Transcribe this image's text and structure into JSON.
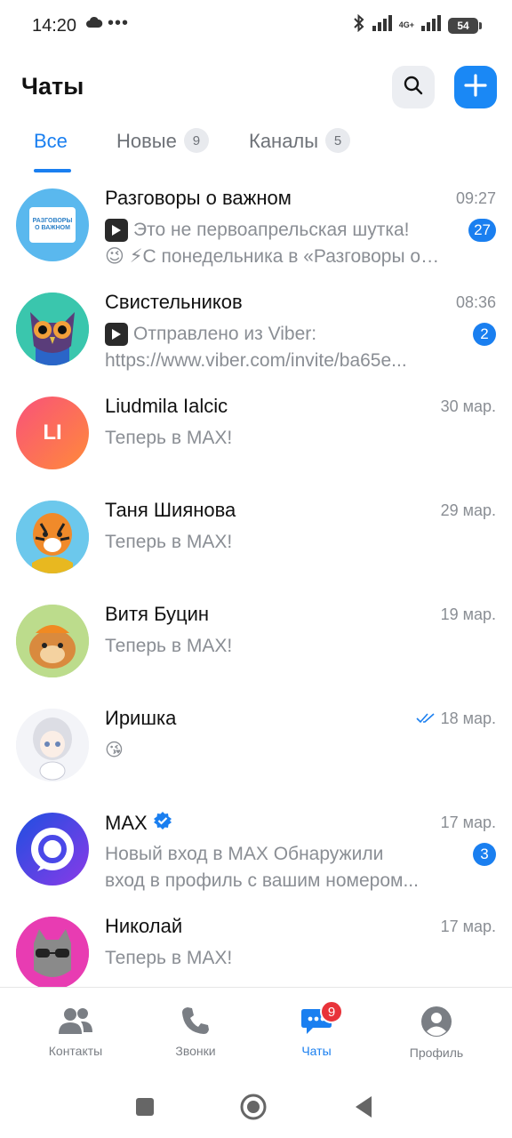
{
  "status_bar": {
    "time": "14:20",
    "dots": "•••",
    "network": "4G+",
    "battery": "54"
  },
  "header": {
    "title": "Чаты"
  },
  "tabs": [
    {
      "label": "Все",
      "count": ""
    },
    {
      "label": "Новые",
      "count": "9"
    },
    {
      "label": "Каналы",
      "count": "5"
    }
  ],
  "chats": [
    {
      "name": "Разговоры о важном",
      "time": "09:27",
      "line1": "Это не первоапрельская шутка!",
      "line2": "😉 ⚡С понедельника в «Разговоры о важном»",
      "unread": "27",
      "avatar_text": "РАЗГОВОРЫ О ВАЖНОМ"
    },
    {
      "name": "Свистельников",
      "time": "08:36",
      "line1": "Отправлено из Viber:",
      "line2": "https://www.viber.com/invite/ba65e...",
      "unread": "2"
    },
    {
      "name": "Liudmila Ialcic",
      "time": "30 мар.",
      "line1": "Теперь в MAX!",
      "avatar_text": "LI"
    },
    {
      "name": "Таня Шиянова",
      "time": "29 мар.",
      "line1": "Теперь в MAX!"
    },
    {
      "name": "Витя Буцин",
      "time": "19 мар.",
      "line1": "Теперь в MAX!"
    },
    {
      "name": "Иришка",
      "time": "18 мар.",
      "line1": "😘"
    },
    {
      "name": "MAX",
      "time": "17 мар.",
      "line1": "Новый вход в MAX Обнаружили",
      "line2": "вход в профиль с вашим номером...",
      "unread": "3"
    },
    {
      "name": "Николай",
      "time": "17 мар.",
      "line1": "Теперь в MAX!"
    }
  ],
  "bottom_nav": [
    {
      "label": "Контакты"
    },
    {
      "label": "Звонки"
    },
    {
      "label": "Чаты",
      "badge": "9"
    },
    {
      "label": "Профиль"
    }
  ],
  "colors": {
    "accent": "#1a7ff0",
    "badge_red": "#e8333a",
    "muted": "#8a8e94"
  }
}
